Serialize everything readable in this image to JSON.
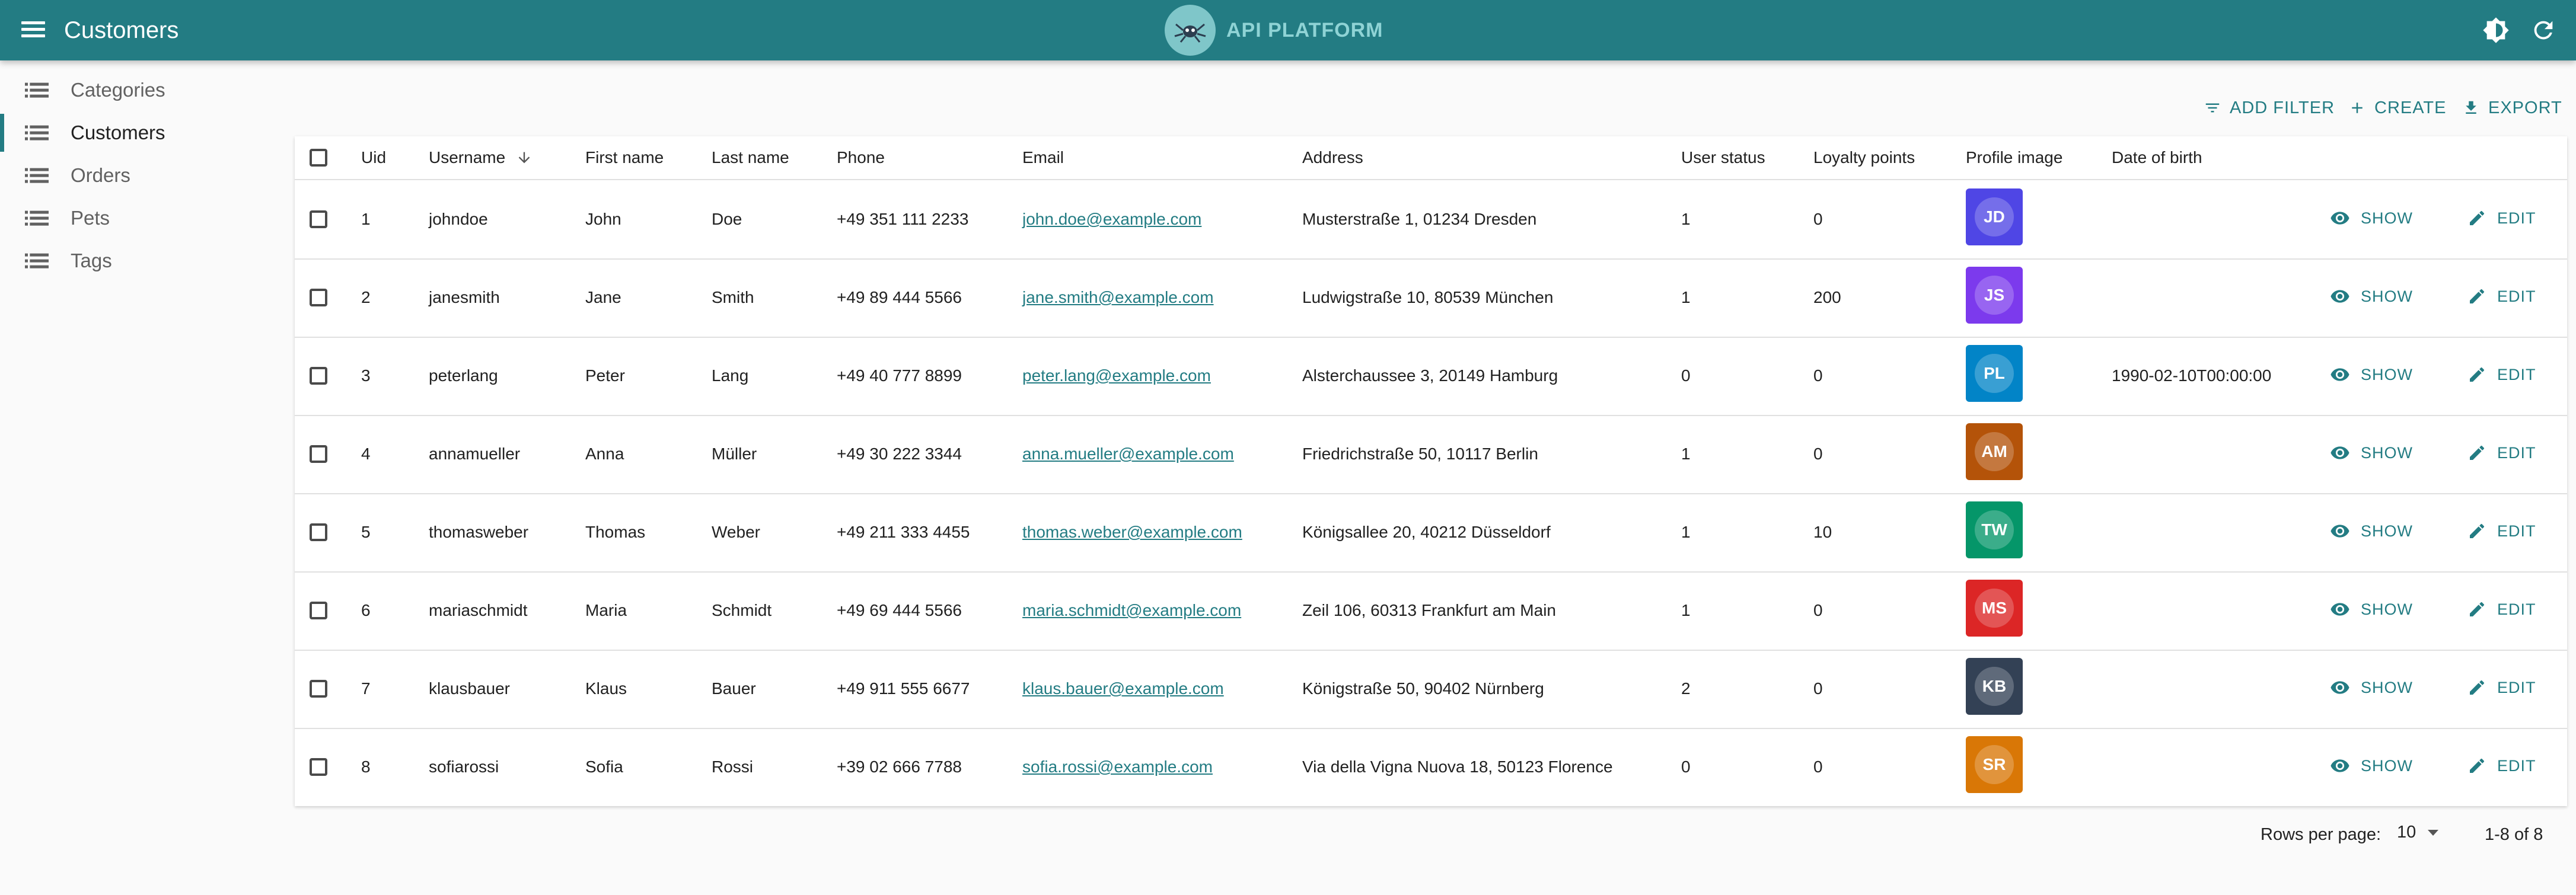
{
  "appbar": {
    "title": "Customers",
    "logo_text": "API PLATFORM"
  },
  "sidebar": {
    "items": [
      {
        "label": "Categories",
        "active": false
      },
      {
        "label": "Customers",
        "active": true
      },
      {
        "label": "Orders",
        "active": false
      },
      {
        "label": "Pets",
        "active": false
      },
      {
        "label": "Tags",
        "active": false
      }
    ]
  },
  "toolbar": {
    "add_filter": "ADD FILTER",
    "create": "CREATE",
    "export": "EXPORT"
  },
  "table": {
    "headers": {
      "uid": "Uid",
      "username": "Username",
      "first_name": "First name",
      "last_name": "Last name",
      "phone": "Phone",
      "email": "Email",
      "address": "Address",
      "user_status": "User status",
      "loyalty_points": "Loyalty points",
      "profile_image": "Profile image",
      "date_of_birth": "Date of birth"
    },
    "sort_column": "username",
    "rows": [
      {
        "uid": "1",
        "username": "johndoe",
        "first_name": "John",
        "last_name": "Doe",
        "phone": "+49 351 111 2233",
        "email": "john.doe@example.com",
        "address": "Musterstraße 1, 01234 Dresden",
        "user_status": "1",
        "loyalty_points": "0",
        "avatar": "JD",
        "avatar_color": "#4f46e5",
        "dob": ""
      },
      {
        "uid": "2",
        "username": "janesmith",
        "first_name": "Jane",
        "last_name": "Smith",
        "phone": "+49 89 444 5566",
        "email": "jane.smith@example.com",
        "address": "Ludwigstraße 10, 80539 München",
        "user_status": "1",
        "loyalty_points": "200",
        "avatar": "JS",
        "avatar_color": "#7c3aed",
        "dob": ""
      },
      {
        "uid": "3",
        "username": "peterlang",
        "first_name": "Peter",
        "last_name": "Lang",
        "phone": "+49 40 777 8899",
        "email": "peter.lang@example.com",
        "address": "Alsterchaussee 3, 20149 Hamburg",
        "user_status": "0",
        "loyalty_points": "0",
        "avatar": "PL",
        "avatar_color": "#0284c7",
        "dob": "1990-02-10T00:00:00"
      },
      {
        "uid": "4",
        "username": "annamueller",
        "first_name": "Anna",
        "last_name": "Müller",
        "phone": "+49 30 222 3344",
        "email": "anna.mueller@example.com",
        "address": "Friedrichstraße 50, 10117 Berlin",
        "user_status": "1",
        "loyalty_points": "0",
        "avatar": "AM",
        "avatar_color": "#b45309",
        "dob": ""
      },
      {
        "uid": "5",
        "username": "thomasweber",
        "first_name": "Thomas",
        "last_name": "Weber",
        "phone": "+49 211 333 4455",
        "email": "thomas.weber@example.com",
        "address": "Königsallee 20, 40212 Düsseldorf",
        "user_status": "1",
        "loyalty_points": "10",
        "avatar": "TW",
        "avatar_color": "#059669",
        "dob": ""
      },
      {
        "uid": "6",
        "username": "mariaschmidt",
        "first_name": "Maria",
        "last_name": "Schmidt",
        "phone": "+49 69 444 5566",
        "email": "maria.schmidt@example.com",
        "address": "Zeil 106, 60313 Frankfurt am Main",
        "user_status": "1",
        "loyalty_points": "0",
        "avatar": "MS",
        "avatar_color": "#dc2626",
        "dob": ""
      },
      {
        "uid": "7",
        "username": "klausbauer",
        "first_name": "Klaus",
        "last_name": "Bauer",
        "phone": "+49 911 555 6677",
        "email": "klaus.bauer@example.com",
        "address": "Königstraße 50, 90402 Nürnberg",
        "user_status": "2",
        "loyalty_points": "0",
        "avatar": "KB",
        "avatar_color": "#334155",
        "dob": ""
      },
      {
        "uid": "8",
        "username": "sofiarossi",
        "first_name": "Sofia",
        "last_name": "Rossi",
        "phone": "+39 02 666 7788",
        "email": "sofia.rossi@example.com",
        "address": "Via della Vigna Nuova 18, 50123 Florence",
        "user_status": "0",
        "loyalty_points": "0",
        "avatar": "SR",
        "avatar_color": "#d97706",
        "dob": ""
      }
    ],
    "show_label": "SHOW",
    "edit_label": "EDIT"
  },
  "pagination": {
    "rows_per_page_label": "Rows per page:",
    "rows_per_page": "10",
    "range": "1-8 of 8"
  }
}
